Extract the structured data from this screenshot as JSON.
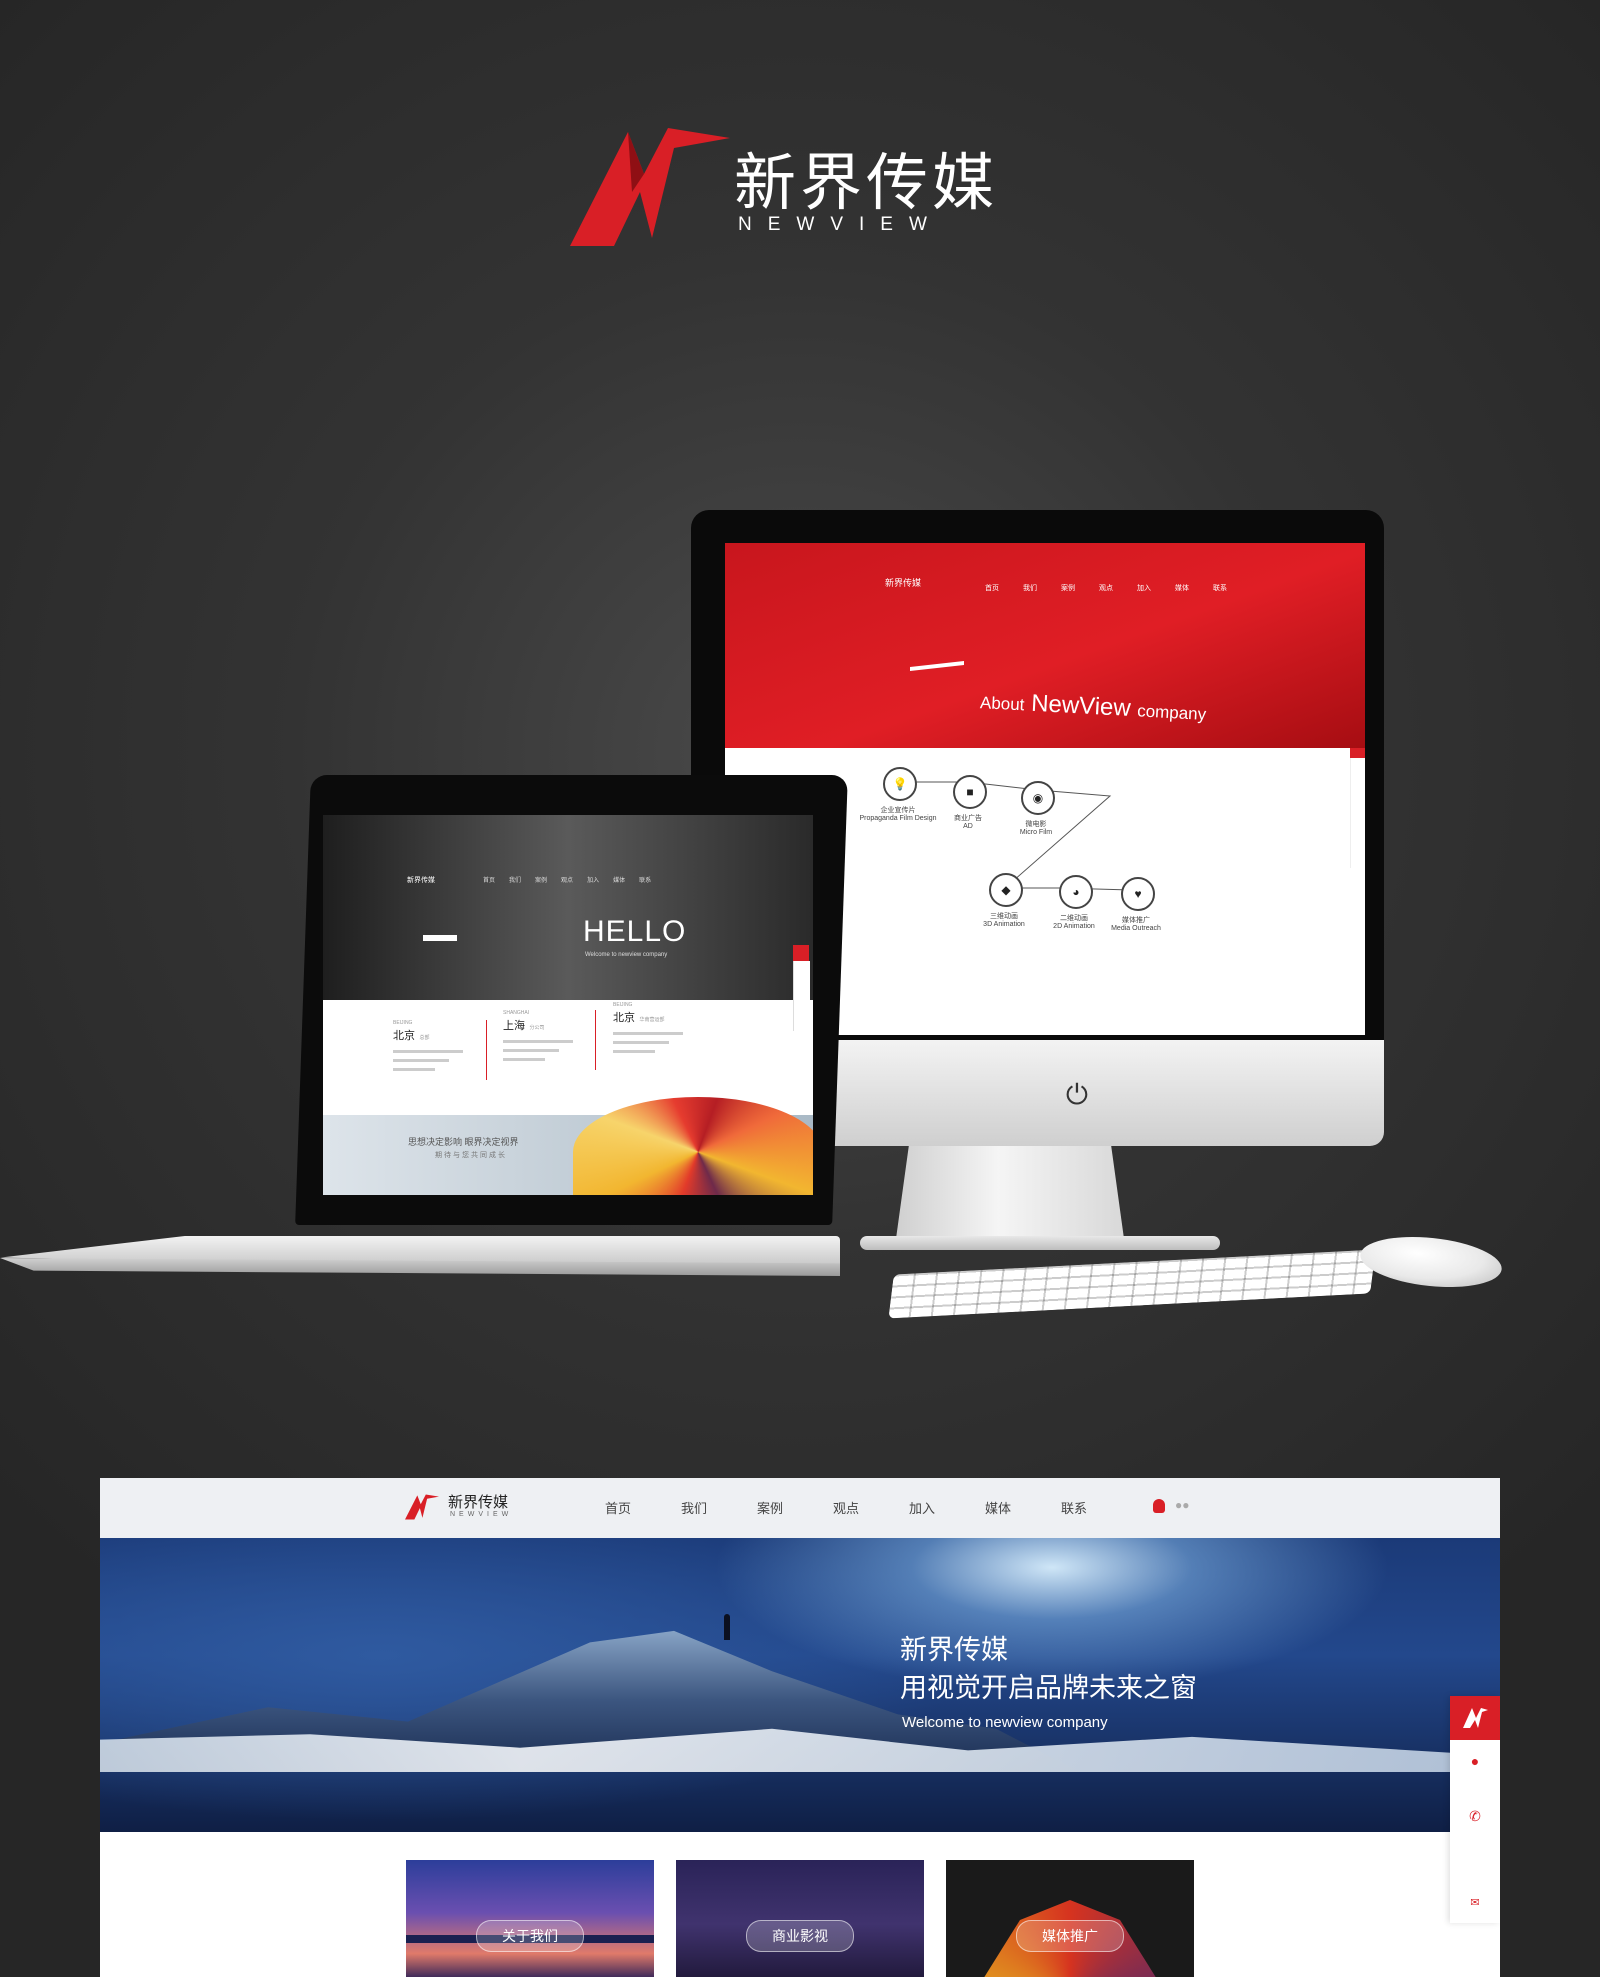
{
  "brand": {
    "name_cn": "新界传媒",
    "name_en": "NEWVIEW",
    "color": "#d91f26"
  },
  "imac_page": {
    "logo": "新界传媒",
    "nav": [
      "首页",
      "我们",
      "案例",
      "观点",
      "加入",
      "媒体",
      "联系"
    ],
    "title_prefix": "About",
    "title_brand": "NewView",
    "title_suffix": "company",
    "services": [
      {
        "icon": "lightbulb-icon",
        "cn": "企业宣传片",
        "en": "Propaganda Film Design"
      },
      {
        "icon": "video-camera-icon",
        "cn": "商业广告",
        "en": "AD"
      },
      {
        "icon": "photo-camera-icon",
        "cn": "微电影",
        "en": "Micro Film"
      },
      {
        "icon": "cube-icon",
        "cn": "三维动画",
        "en": "3D Animation"
      },
      {
        "icon": "pacman-icon",
        "cn": "二维动画",
        "en": "2D Animation"
      },
      {
        "icon": "heart-icon",
        "cn": "媒体推广",
        "en": "Media Outreach"
      }
    ]
  },
  "laptop_page": {
    "logo": "新界传媒",
    "nav": [
      "首页",
      "我们",
      "案例",
      "观点",
      "加入",
      "媒体",
      "联系"
    ],
    "hero_title": "HELLO",
    "hero_sub": "Welcome to newview company",
    "offices": [
      {
        "en": "BEIJING",
        "cn": "北京",
        "tag": "总部"
      },
      {
        "en": "SHANGHAI",
        "cn": "上海",
        "tag": "分公司"
      },
      {
        "en": "BEIJING",
        "cn": "北京",
        "tag": "华南营运部"
      }
    ],
    "banner_line1": "思想决定影响   眼界决定视界",
    "banner_line2": "期待与您共同成长"
  },
  "site": {
    "logo_cn": "新界传媒",
    "logo_en": "NEWVIEW",
    "menu": [
      "首页",
      "我们",
      "案例",
      "观点",
      "加入",
      "媒体",
      "联系"
    ],
    "hero_line1": "新界传媒",
    "hero_line2": "用视觉开启品牌未来之窗",
    "hero_line3": "Welcome to newview company",
    "tiles": [
      "关于我们",
      "商业影视",
      "媒体推广"
    ],
    "side_icons": [
      "qq-icon",
      "phone-icon",
      "mail-icon"
    ]
  }
}
